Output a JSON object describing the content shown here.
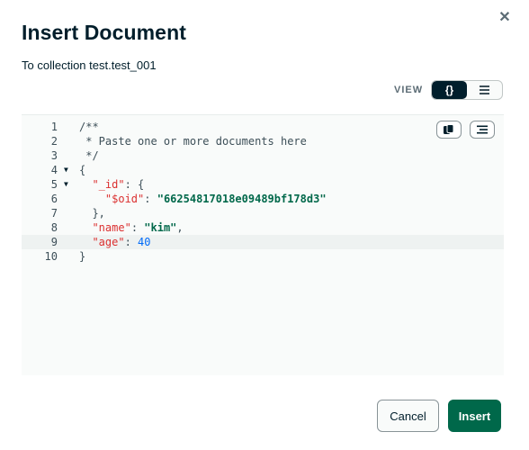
{
  "dialog": {
    "title": "Insert Document",
    "subtitle": "To collection test.test_001",
    "close_icon": "close-icon"
  },
  "view_toggle": {
    "label": "VIEW",
    "options": [
      {
        "label": "{}",
        "icon": "json-braces-icon",
        "active": true
      },
      {
        "label": "",
        "icon": "list-icon",
        "active": false
      }
    ]
  },
  "editor": {
    "toolbar_icons": [
      "copy-icon",
      "format-icon"
    ],
    "lines": [
      {
        "num": "1",
        "fold": false,
        "active": false
      },
      {
        "num": "2",
        "fold": false,
        "active": false
      },
      {
        "num": "3",
        "fold": false,
        "active": false
      },
      {
        "num": "4",
        "fold": true,
        "active": false
      },
      {
        "num": "5",
        "fold": true,
        "active": false
      },
      {
        "num": "6",
        "fold": false,
        "active": false
      },
      {
        "num": "7",
        "fold": false,
        "active": false
      },
      {
        "num": "8",
        "fold": false,
        "active": false
      },
      {
        "num": "9",
        "fold": false,
        "active": true
      },
      {
        "num": "10",
        "fold": false,
        "active": false
      }
    ],
    "code": {
      "l1": "/**",
      "l2": " * Paste one or more documents here",
      "l3": " */",
      "l4": "{",
      "l5_key": "\"_id\"",
      "l5_rest": ": {",
      "l6_key": "\"$oid\"",
      "l6_sep": ": ",
      "l6_val": "\"66254817018e09489bf178d3\"",
      "l7": "},",
      "l8_key": "\"name\"",
      "l8_sep": ": ",
      "l8_val": "\"kim\"",
      "l8_end": ",",
      "l9_key": "\"age\"",
      "l9_sep": ": ",
      "l9_val": "40",
      "l10": "}"
    }
  },
  "footer": {
    "cancel_label": "Cancel",
    "insert_label": "Insert"
  },
  "colors": {
    "primary_green": "#00684a",
    "dark": "#001e2b",
    "json_key": "#db3030",
    "json_number": "#016bf8"
  }
}
